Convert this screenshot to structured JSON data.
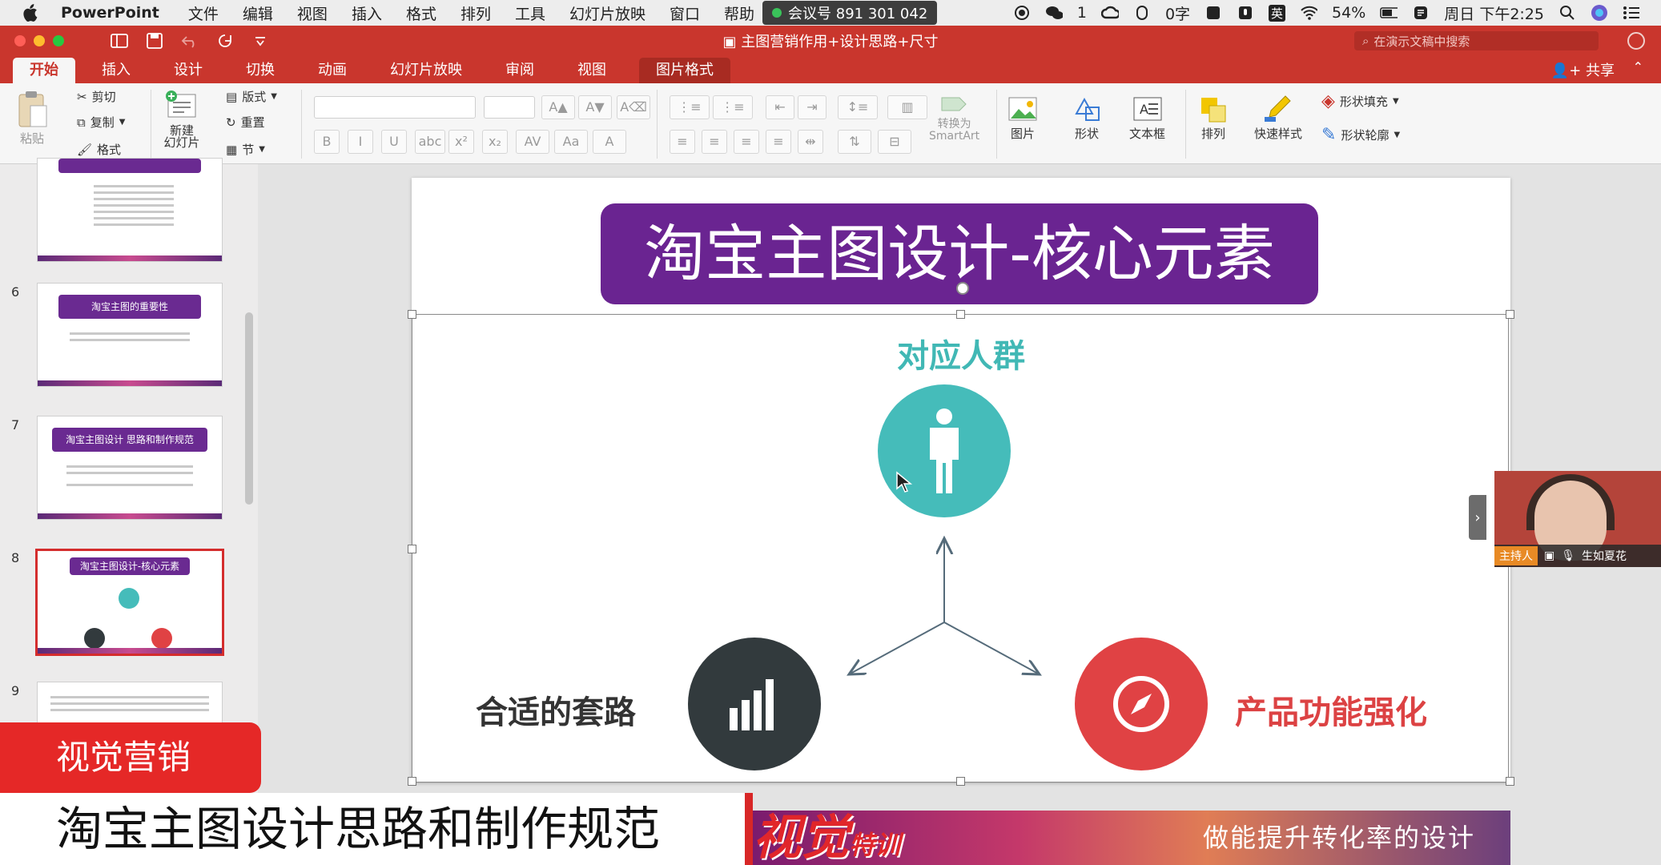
{
  "menubar": {
    "app_name": "PowerPoint",
    "items": [
      "文件",
      "编辑",
      "视图",
      "插入",
      "格式",
      "排列",
      "工具",
      "幻灯片放映",
      "窗口",
      "帮助"
    ],
    "meeting": "会议号 891 301 042",
    "wechat_count": "1",
    "network": "0字",
    "input_method": "英",
    "battery": "54%",
    "clock": "周日 下午2:25"
  },
  "titlebar": {
    "document_title": "主图营销作用+设计思路+尺寸",
    "search_placeholder": "在演示文稿中搜索"
  },
  "ribbon_tabs": {
    "tabs": [
      "开始",
      "插入",
      "设计",
      "切换",
      "动画",
      "幻灯片放映",
      "审阅",
      "视图",
      "图片格式"
    ],
    "share": "共享"
  },
  "ribbon": {
    "paste": "粘贴",
    "cut": "剪切",
    "copy": "复制",
    "format": "格式",
    "new_slide": "新建\n幻灯片",
    "layout": "版式",
    "reset": "重置",
    "section": "节",
    "bold": "B",
    "italic": "I",
    "underline": "U",
    "strike": "abc",
    "superscript": "x²",
    "subscript": "x₂",
    "convert_smartart": "转换为\nSmartArt",
    "picture": "图片",
    "shape": "形状",
    "textbox": "文本框",
    "arrange": "排列",
    "quick_styles": "快速样式",
    "shape_fill": "形状填充",
    "shape_outline": "形状轮廓"
  },
  "thumbnails": [
    {
      "num": "",
      "title": ""
    },
    {
      "num": "6",
      "title": "淘宝主图的重要性"
    },
    {
      "num": "7",
      "title": "淘宝主图设计 思路和制作规范"
    },
    {
      "num": "8",
      "title": "淘宝主图设计-核心元素"
    },
    {
      "num": "9",
      "title": ""
    }
  ],
  "slide": {
    "title": "淘宝主图设计-核心元素",
    "top_label": "对应人群",
    "left_label": "合适的套路",
    "right_label": "产品功能强化"
  },
  "banner": {
    "brand": "视觉",
    "brand_suffix": "特训",
    "tagline": "做能提升转化率的设计"
  },
  "captions": {
    "red": "视觉营销",
    "white": "淘宝主图设计思路和制作规范"
  },
  "presenter": {
    "role": "主持人",
    "name": "生如夏花"
  },
  "colors": {
    "accent_red": "#c9362d",
    "slide_purple": "#6a2491",
    "teal": "#45bcba",
    "dark": "#323a3d",
    "red": "#e04244"
  }
}
